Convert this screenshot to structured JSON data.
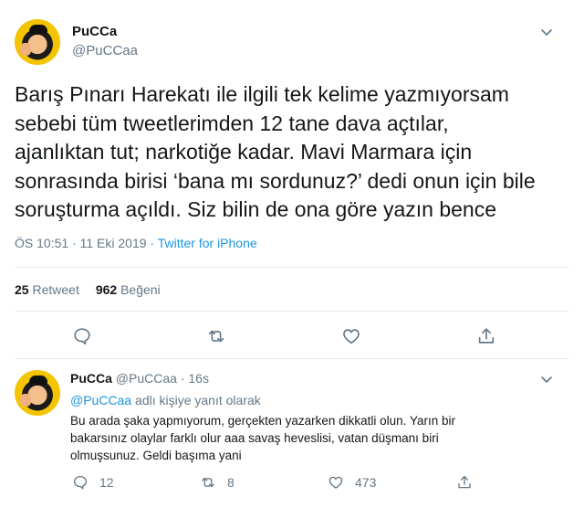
{
  "tweet": {
    "author_name": "PuCCa",
    "author_handle": "@PuCCaa",
    "text": "Barış Pınarı Harekatı ile ilgili tek kelime yazmıyorsam\nsebebi tüm tweetlerimden 12 tane dava açtılar,\najanlıktan tut; narkotiğe kadar. Mavi Marmara için\nsonrasında birisi ‘bana mı sordunuz?’ dedi onun için bile\nsoruşturma açıldı. Siz bilin de ona göre yazın bence",
    "time": "ÖS 10:51",
    "separator_1": " · ",
    "date": "11 Eki 2019",
    "separator_2": " · ",
    "source": "Twitter for iPhone",
    "retweet_count": "25",
    "retweet_label": "Retweet",
    "like_count": "962",
    "like_label": "Beğeni"
  },
  "reply": {
    "author_name": "PuCCa",
    "author_handle": "@PuCCaa",
    "separator": " · ",
    "age": "16s",
    "reply_to_mention": "@PuCCaa",
    "reply_to_suffix": " adlı kişiye yanıt olarak",
    "text": "Bu arada şaka yapmıyorum, gerçekten yazarken dikkatli olun. Yarın bir\nbakarsınız olaylar farklı olur aaa savaş heveslisi, vatan düşmanı biri\nolmuşsunuz. Geldi başıma yani",
    "reply_count": "12",
    "retweet_count": "8",
    "like_count": "473"
  },
  "icons": {
    "caret": "chevron-down-icon",
    "reply": "reply-icon",
    "retweet": "retweet-icon",
    "like": "heart-icon",
    "share": "share-icon"
  }
}
